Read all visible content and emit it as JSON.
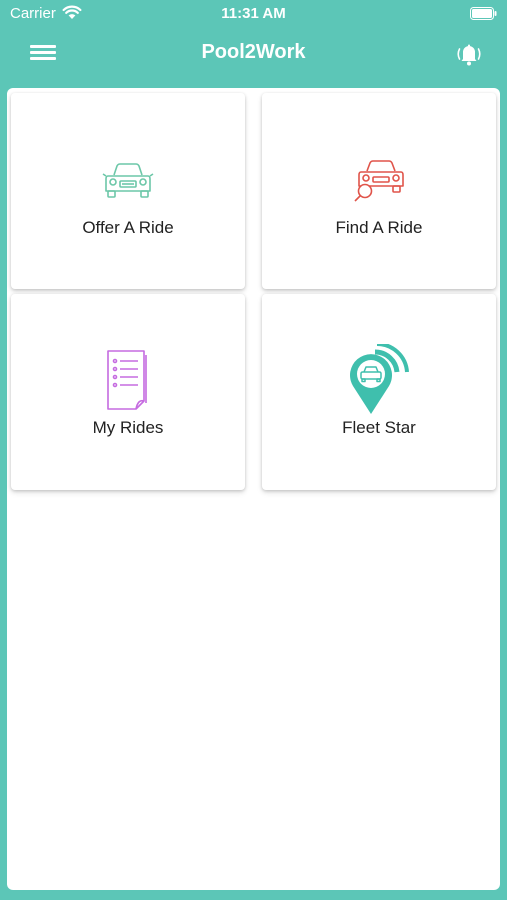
{
  "status_bar": {
    "carrier": "Carrier",
    "time": "11:31 AM"
  },
  "nav": {
    "title": "Pool2Work",
    "menu_icon": "hamburger-menu-icon",
    "bell_icon": "bell-ringing-icon"
  },
  "tiles": [
    {
      "label": "Offer A Ride",
      "icon": "car-icon",
      "color": "#6cc7a8"
    },
    {
      "label": "Find A Ride",
      "icon": "car-search-icon",
      "color": "#e0544a"
    },
    {
      "label": "My Rides",
      "icon": "list-document-icon",
      "color": "#c56be0"
    },
    {
      "label": "Fleet Star",
      "icon": "location-car-icon",
      "color": "#3fbfad"
    }
  ],
  "colors": {
    "primary": "#5cc6b7",
    "background": "#ffffff"
  }
}
